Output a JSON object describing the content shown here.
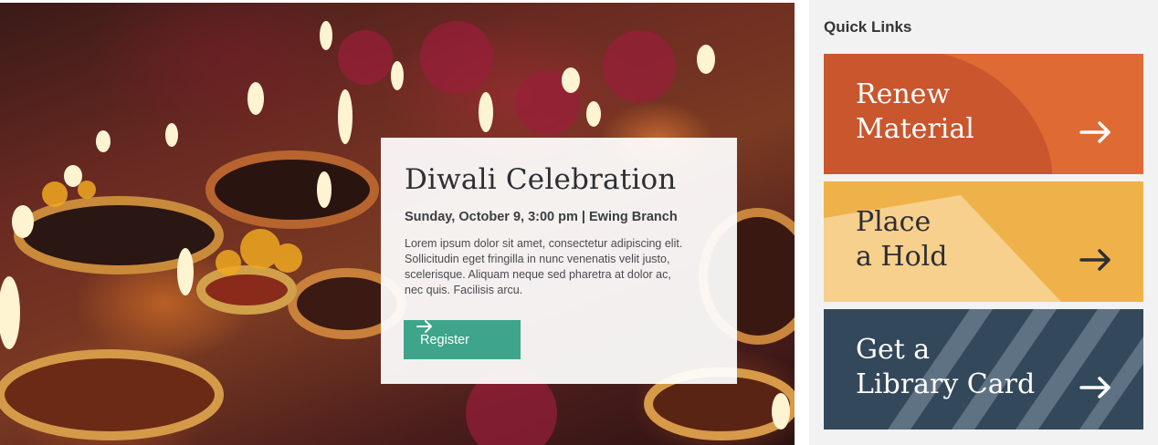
{
  "hero": {
    "event": {
      "title": "Diwali Celebration",
      "meta": "Sunday, October 9, 3:00 pm | Ewing Branch",
      "description": "Lorem ipsum dolor sit amet, consectetur adipiscing elit. Sollicitudin eget fringilla in nunc venenatis velit justo, scelerisque. Aliquam neque sed pharetra at dolor ac, nec quis. Facilisis arcu.",
      "button_label": "Register",
      "button_icon": "arrow-right-icon"
    }
  },
  "sidebar": {
    "title": "Quick Links",
    "links": [
      {
        "line1": "Renew",
        "line2": "Material",
        "color": "#d9622f",
        "icon": "arrow-right-icon"
      },
      {
        "line1": "Place",
        "line2": "a Hold",
        "color": "#efb24a",
        "icon": "arrow-right-icon"
      },
      {
        "line1": "Get a",
        "line2": "Library Card",
        "color": "#33485a",
        "icon": "arrow-right-icon"
      }
    ]
  },
  "colors": {
    "register": "#3ea58a",
    "renew": "#d9622f",
    "hold": "#efb24a",
    "card": "#33485a"
  }
}
